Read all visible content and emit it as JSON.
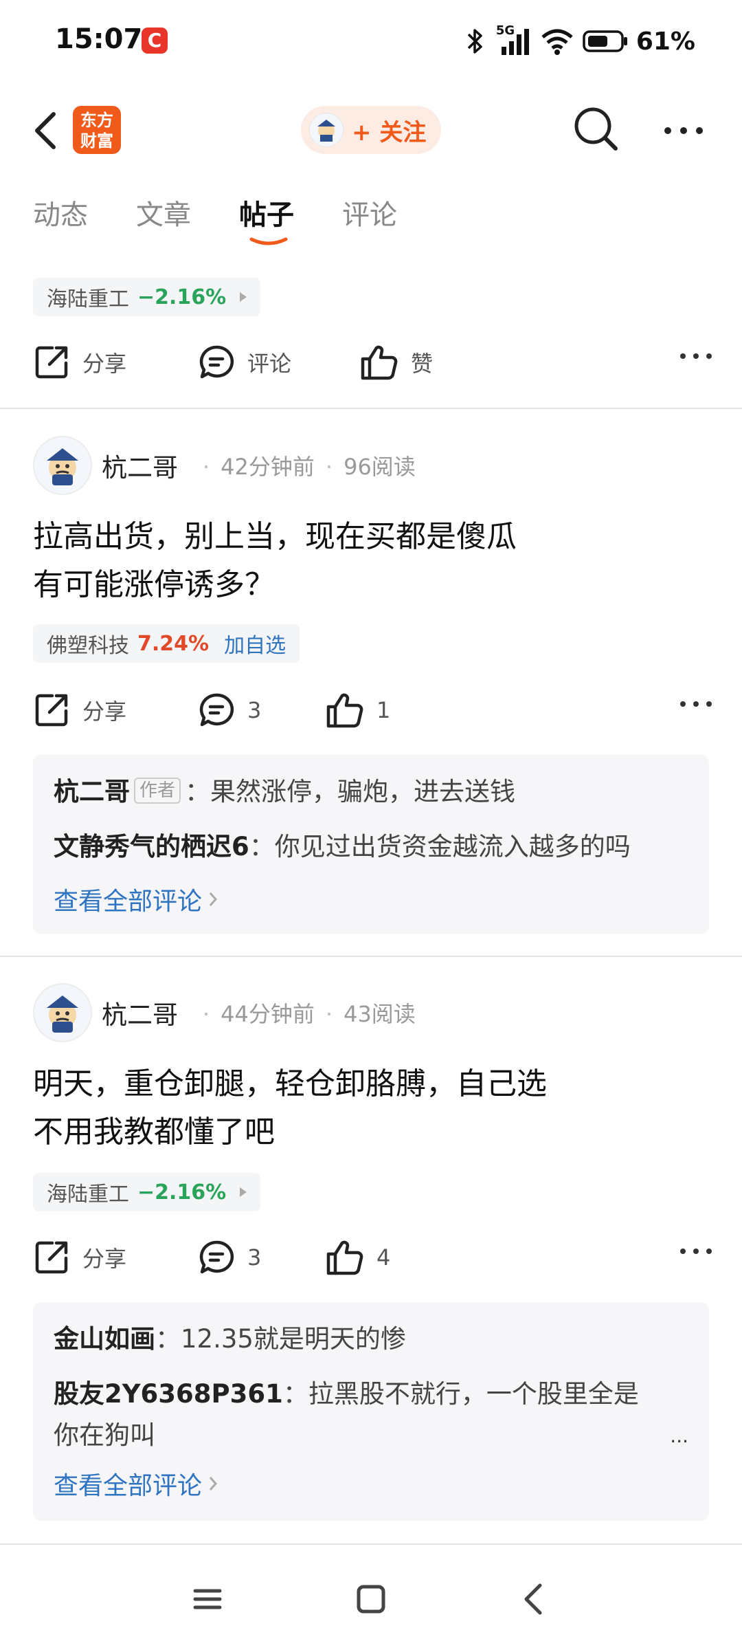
{
  "status_bar": {
    "time": "15:07",
    "app_badge": "C",
    "network": "5G",
    "battery": "61%"
  },
  "header": {
    "logo_line1": "东方",
    "logo_line2": "财富",
    "follow_label": "+ 关注",
    "accent_color": "#f05a1a"
  },
  "tabs": [
    {
      "label": "动态",
      "active": false
    },
    {
      "label": "文章",
      "active": false
    },
    {
      "label": "帖子",
      "active": true
    },
    {
      "label": "评论",
      "active": false
    }
  ],
  "top_partial": {
    "stock": {
      "name": "海陆重工",
      "change": "−2.16%"
    },
    "share_label": "分享",
    "comment_label": "评论",
    "like_label": "赞"
  },
  "posts": [
    {
      "author": "杭二哥",
      "time": "42分钟前",
      "reads": "96阅读",
      "text_lines": [
        "拉高出货，别上当，现在买都是傻瓜",
        "有可能涨停诱多？"
      ],
      "stock": {
        "name": "佛塑科技",
        "change": "7.24%",
        "add_label": "加自选"
      },
      "share_label": "分享",
      "comments_count": "3",
      "likes_count": "1",
      "comments": [
        {
          "name": "杭二哥",
          "badge": "作者",
          "text": "果然涨停，骗炮，进去送钱"
        },
        {
          "name": "文静秀气的栖迟6",
          "text": "你见过出货资金越流入越多的吗"
        }
      ],
      "view_all": "查看全部评论"
    },
    {
      "author": "杭二哥",
      "time": "44分钟前",
      "reads": "43阅读",
      "text_lines": [
        "明天，重仓卸腿，轻仓卸胳膊，自己选",
        "不用我教都懂了吧"
      ],
      "stock": {
        "name": "海陆重工",
        "change": "−2.16%"
      },
      "share_label": "分享",
      "comments_count": "3",
      "likes_count": "4",
      "comments": [
        {
          "name": "金山如画",
          "text": "12.35就是明天的惨"
        },
        {
          "name": "股友2Y6368P361",
          "text_line1": "拉黑股不就行，一个股里全是",
          "text_line2": "你在狗叫"
        }
      ],
      "more": "...",
      "view_all": "查看全部评论"
    }
  ],
  "colors": {
    "down": "#2aa35b",
    "up": "#e04a2a",
    "link": "#2f74c0"
  }
}
